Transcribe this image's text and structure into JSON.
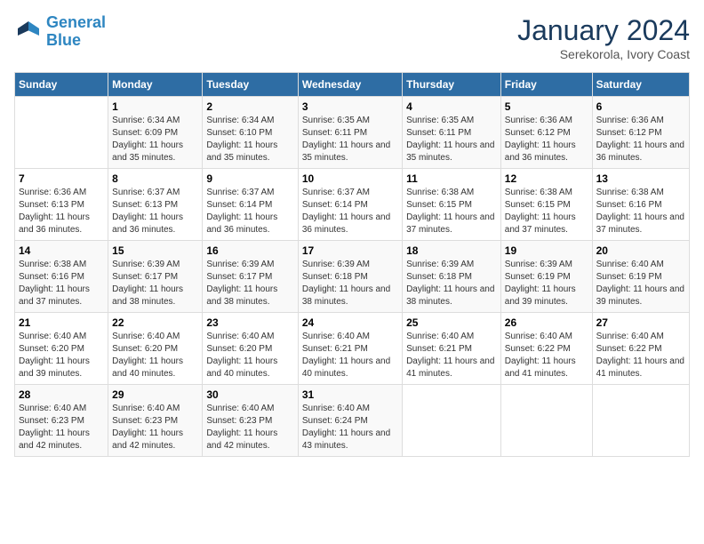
{
  "logo": {
    "line1": "General",
    "line2": "Blue"
  },
  "title": "January 2024",
  "subtitle": "Serekorola, Ivory Coast",
  "days_of_week": [
    "Sunday",
    "Monday",
    "Tuesday",
    "Wednesday",
    "Thursday",
    "Friday",
    "Saturday"
  ],
  "weeks": [
    [
      {
        "day": "",
        "sunrise": "",
        "sunset": "",
        "daylight": ""
      },
      {
        "day": "1",
        "sunrise": "Sunrise: 6:34 AM",
        "sunset": "Sunset: 6:09 PM",
        "daylight": "Daylight: 11 hours and 35 minutes."
      },
      {
        "day": "2",
        "sunrise": "Sunrise: 6:34 AM",
        "sunset": "Sunset: 6:10 PM",
        "daylight": "Daylight: 11 hours and 35 minutes."
      },
      {
        "day": "3",
        "sunrise": "Sunrise: 6:35 AM",
        "sunset": "Sunset: 6:11 PM",
        "daylight": "Daylight: 11 hours and 35 minutes."
      },
      {
        "day": "4",
        "sunrise": "Sunrise: 6:35 AM",
        "sunset": "Sunset: 6:11 PM",
        "daylight": "Daylight: 11 hours and 35 minutes."
      },
      {
        "day": "5",
        "sunrise": "Sunrise: 6:36 AM",
        "sunset": "Sunset: 6:12 PM",
        "daylight": "Daylight: 11 hours and 36 minutes."
      },
      {
        "day": "6",
        "sunrise": "Sunrise: 6:36 AM",
        "sunset": "Sunset: 6:12 PM",
        "daylight": "Daylight: 11 hours and 36 minutes."
      }
    ],
    [
      {
        "day": "7",
        "sunrise": "Sunrise: 6:36 AM",
        "sunset": "Sunset: 6:13 PM",
        "daylight": "Daylight: 11 hours and 36 minutes."
      },
      {
        "day": "8",
        "sunrise": "Sunrise: 6:37 AM",
        "sunset": "Sunset: 6:13 PM",
        "daylight": "Daylight: 11 hours and 36 minutes."
      },
      {
        "day": "9",
        "sunrise": "Sunrise: 6:37 AM",
        "sunset": "Sunset: 6:14 PM",
        "daylight": "Daylight: 11 hours and 36 minutes."
      },
      {
        "day": "10",
        "sunrise": "Sunrise: 6:37 AM",
        "sunset": "Sunset: 6:14 PM",
        "daylight": "Daylight: 11 hours and 36 minutes."
      },
      {
        "day": "11",
        "sunrise": "Sunrise: 6:38 AM",
        "sunset": "Sunset: 6:15 PM",
        "daylight": "Daylight: 11 hours and 37 minutes."
      },
      {
        "day": "12",
        "sunrise": "Sunrise: 6:38 AM",
        "sunset": "Sunset: 6:15 PM",
        "daylight": "Daylight: 11 hours and 37 minutes."
      },
      {
        "day": "13",
        "sunrise": "Sunrise: 6:38 AM",
        "sunset": "Sunset: 6:16 PM",
        "daylight": "Daylight: 11 hours and 37 minutes."
      }
    ],
    [
      {
        "day": "14",
        "sunrise": "Sunrise: 6:38 AM",
        "sunset": "Sunset: 6:16 PM",
        "daylight": "Daylight: 11 hours and 37 minutes."
      },
      {
        "day": "15",
        "sunrise": "Sunrise: 6:39 AM",
        "sunset": "Sunset: 6:17 PM",
        "daylight": "Daylight: 11 hours and 38 minutes."
      },
      {
        "day": "16",
        "sunrise": "Sunrise: 6:39 AM",
        "sunset": "Sunset: 6:17 PM",
        "daylight": "Daylight: 11 hours and 38 minutes."
      },
      {
        "day": "17",
        "sunrise": "Sunrise: 6:39 AM",
        "sunset": "Sunset: 6:18 PM",
        "daylight": "Daylight: 11 hours and 38 minutes."
      },
      {
        "day": "18",
        "sunrise": "Sunrise: 6:39 AM",
        "sunset": "Sunset: 6:18 PM",
        "daylight": "Daylight: 11 hours and 38 minutes."
      },
      {
        "day": "19",
        "sunrise": "Sunrise: 6:39 AM",
        "sunset": "Sunset: 6:19 PM",
        "daylight": "Daylight: 11 hours and 39 minutes."
      },
      {
        "day": "20",
        "sunrise": "Sunrise: 6:40 AM",
        "sunset": "Sunset: 6:19 PM",
        "daylight": "Daylight: 11 hours and 39 minutes."
      }
    ],
    [
      {
        "day": "21",
        "sunrise": "Sunrise: 6:40 AM",
        "sunset": "Sunset: 6:20 PM",
        "daylight": "Daylight: 11 hours and 39 minutes."
      },
      {
        "day": "22",
        "sunrise": "Sunrise: 6:40 AM",
        "sunset": "Sunset: 6:20 PM",
        "daylight": "Daylight: 11 hours and 40 minutes."
      },
      {
        "day": "23",
        "sunrise": "Sunrise: 6:40 AM",
        "sunset": "Sunset: 6:20 PM",
        "daylight": "Daylight: 11 hours and 40 minutes."
      },
      {
        "day": "24",
        "sunrise": "Sunrise: 6:40 AM",
        "sunset": "Sunset: 6:21 PM",
        "daylight": "Daylight: 11 hours and 40 minutes."
      },
      {
        "day": "25",
        "sunrise": "Sunrise: 6:40 AM",
        "sunset": "Sunset: 6:21 PM",
        "daylight": "Daylight: 11 hours and 41 minutes."
      },
      {
        "day": "26",
        "sunrise": "Sunrise: 6:40 AM",
        "sunset": "Sunset: 6:22 PM",
        "daylight": "Daylight: 11 hours and 41 minutes."
      },
      {
        "day": "27",
        "sunrise": "Sunrise: 6:40 AM",
        "sunset": "Sunset: 6:22 PM",
        "daylight": "Daylight: 11 hours and 41 minutes."
      }
    ],
    [
      {
        "day": "28",
        "sunrise": "Sunrise: 6:40 AM",
        "sunset": "Sunset: 6:23 PM",
        "daylight": "Daylight: 11 hours and 42 minutes."
      },
      {
        "day": "29",
        "sunrise": "Sunrise: 6:40 AM",
        "sunset": "Sunset: 6:23 PM",
        "daylight": "Daylight: 11 hours and 42 minutes."
      },
      {
        "day": "30",
        "sunrise": "Sunrise: 6:40 AM",
        "sunset": "Sunset: 6:23 PM",
        "daylight": "Daylight: 11 hours and 42 minutes."
      },
      {
        "day": "31",
        "sunrise": "Sunrise: 6:40 AM",
        "sunset": "Sunset: 6:24 PM",
        "daylight": "Daylight: 11 hours and 43 minutes."
      },
      {
        "day": "",
        "sunrise": "",
        "sunset": "",
        "daylight": ""
      },
      {
        "day": "",
        "sunrise": "",
        "sunset": "",
        "daylight": ""
      },
      {
        "day": "",
        "sunrise": "",
        "sunset": "",
        "daylight": ""
      }
    ]
  ]
}
